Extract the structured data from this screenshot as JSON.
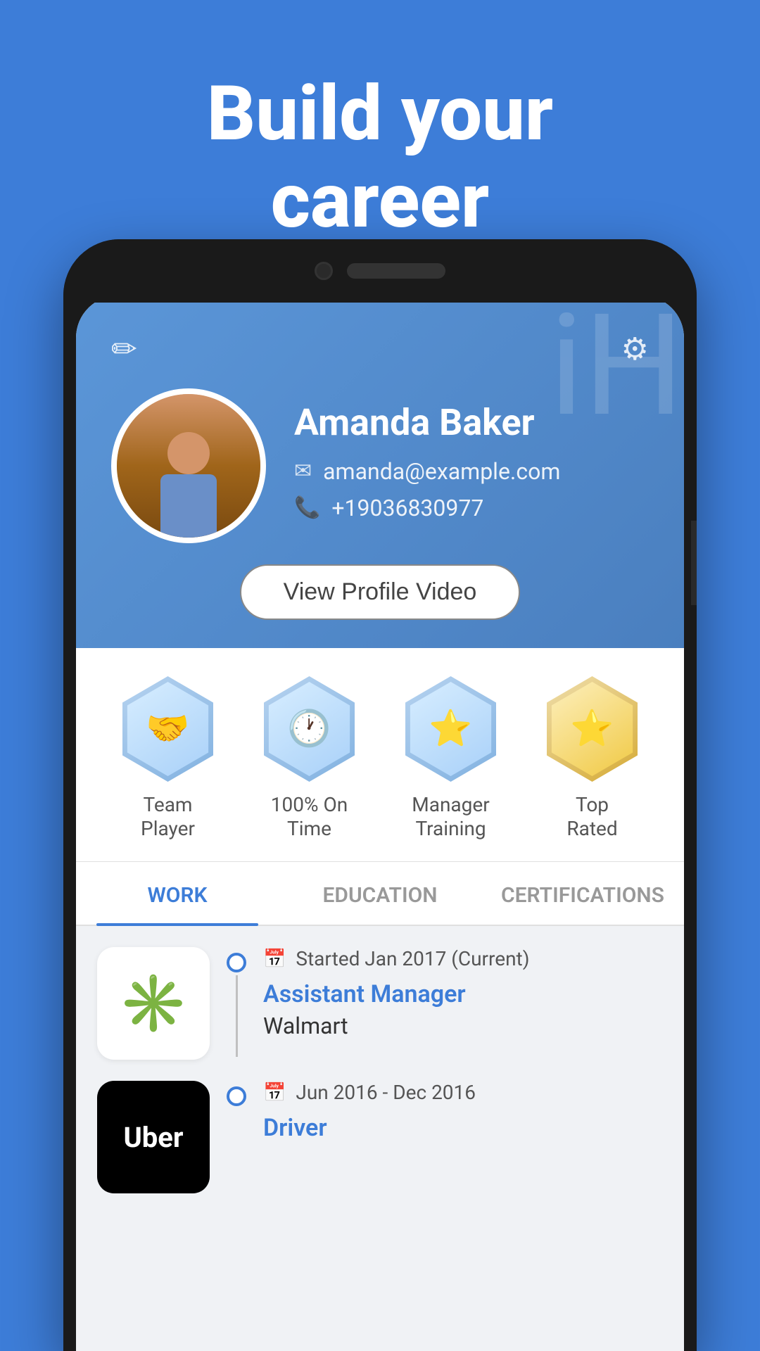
{
  "background_color": "#3d7dd8",
  "header": {
    "line1": "Build your",
    "line2": "career"
  },
  "phone": {
    "profile": {
      "name": "Amanda Baker",
      "email": "amanda@example.com",
      "phone": "+19036830977",
      "view_video_btn": "View Profile Video",
      "edit_icon": "✏",
      "settings_icon": "⚙"
    },
    "badges": [
      {
        "label": "Team\nPlayer",
        "emoji": "🤝",
        "color": "#e8f0fd"
      },
      {
        "label": "100% On\nTime",
        "emoji": "🕐",
        "color": "#e8f0fd"
      },
      {
        "label": "Manager\nTraining",
        "emoji": "⭐",
        "color": "#e8f0fd"
      },
      {
        "label": "Top\nRated",
        "emoji": "⭐⭐",
        "color": "#e8f0fd"
      }
    ],
    "tabs": [
      {
        "label": "WORK",
        "active": true
      },
      {
        "label": "EDUCATION",
        "active": false
      },
      {
        "label": "CERTIFICATIONS",
        "active": false
      }
    ],
    "work_entries": [
      {
        "company": "Walmart",
        "logo_type": "walmart",
        "date": "Started Jan 2017 (Current)",
        "title": "Assistant Manager",
        "is_current": true
      },
      {
        "company": "Uber",
        "logo_type": "uber",
        "date": "Jun 2016 - Dec 2016",
        "title": "Driver",
        "is_current": false
      }
    ]
  }
}
